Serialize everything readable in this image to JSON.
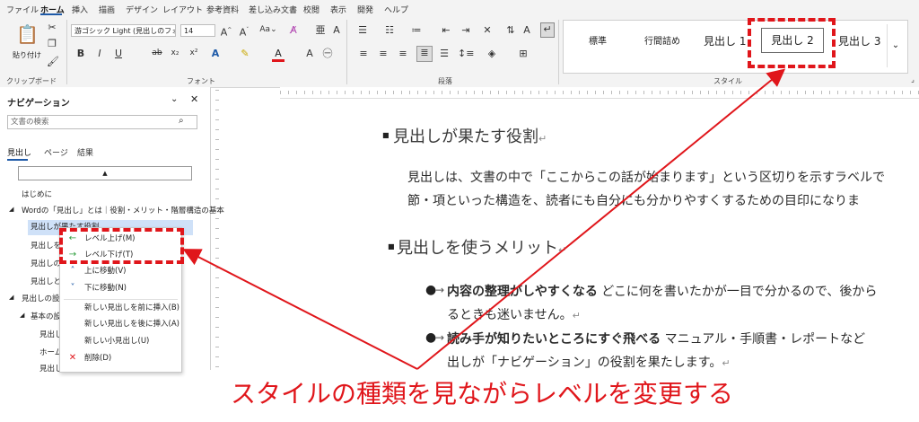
{
  "menu": {
    "tabs": [
      "ファイル",
      "ホーム",
      "挿入",
      "描画",
      "デザイン",
      "レイアウト",
      "参考資料",
      "差し込み文書",
      "校閲",
      "表示",
      "開発",
      "ヘルプ"
    ],
    "active": "ホーム"
  },
  "ribbon": {
    "clipboard": {
      "paste_label": "貼り付け",
      "group_label": "クリップボード"
    },
    "font": {
      "font_name": "游ゴシック Light (見出しのフォン",
      "font_size": "14",
      "group_label": "フォント"
    },
    "paragraph": {
      "group_label": "段落"
    },
    "styles": {
      "items": [
        "標準",
        "行間詰め",
        "見出し 1",
        "見出し 2",
        "見出し 3"
      ],
      "selected": "見出し 2",
      "group_label": "スタイル"
    }
  },
  "nav": {
    "title": "ナビゲーション",
    "search_placeholder": "文書の検索",
    "tabs": [
      "見出し",
      "ページ",
      "結果"
    ],
    "items": [
      {
        "text": "はじめに"
      },
      {
        "text": "Wordの「見出し」とは｜役割・メリット・階層構造の基本"
      },
      {
        "text": "見出しが果たす役割"
      },
      {
        "text": "見出しを使"
      },
      {
        "text": "見出しの階"
      },
      {
        "text": "見出しと目"
      },
      {
        "text": "見出しの設定"
      },
      {
        "text": "基本の設定"
      },
      {
        "text": "見出しを"
      },
      {
        "text": "ホーム"
      },
      {
        "text": "見出し"
      }
    ]
  },
  "context_menu": {
    "items": [
      {
        "icon": "left-arrow-icon",
        "label": "レベル上げ(M)"
      },
      {
        "icon": "right-arrow-icon",
        "label": "レベル下げ(T)"
      },
      {
        "icon": "chevron-up-icon",
        "label": "上に移動(V)"
      },
      {
        "icon": "chevron-down-icon",
        "label": "下に移動(N)"
      },
      {
        "icon": "",
        "label": "新しい見出しを前に挿入(B)"
      },
      {
        "icon": "",
        "label": "新しい見出しを後に挿入(A)"
      },
      {
        "icon": "",
        "label": "新しい小見出し(U)"
      },
      {
        "icon": "close-icon",
        "label": "削除(D)"
      }
    ]
  },
  "document": {
    "heading1": "見出しが果たす役割",
    "para1_line1": "見出しは、文書の中で「ここからこの話が始まります」という区切りを示すラベルで",
    "para1_line2": "節・項といった構造を、読者にも自分にも分かりやすくするための目印になりま",
    "heading2": "見出しを使うメリット",
    "bullet1_bold": "内容の整理がしやすくなる",
    "bullet1_rest": " どこに何を書いたかが一目で分かるので、後から",
    "bullet1_line2": "るときも迷いません。",
    "bullet2_bold": "読み手が知りたいところにすぐ飛べる",
    "bullet2_rest": " マニュアル・手順書・レポートなど",
    "bullet2_line2": "出しが「ナビゲーション」の役割を果たします。"
  },
  "annotation": {
    "caption": "スタイルの種類を見ながらレベルを変更する",
    "color": "#e0161b"
  }
}
